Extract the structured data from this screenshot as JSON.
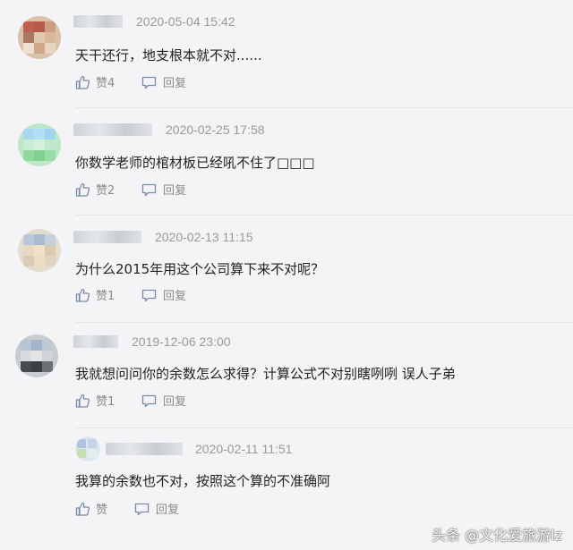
{
  "comments": [
    {
      "time": "2020-05-04 15:42",
      "text": "天干还行，地支根本就不对......",
      "like_label": "赞4",
      "reply_label": "回复"
    },
    {
      "time": "2020-02-25 17:58",
      "text": "你数学老师的棺材板已经吼不住了□□□",
      "like_label": "赞2",
      "reply_label": "回复"
    },
    {
      "time": "2020-02-13 11:15",
      "text": "为什么2015年用这个公司算下来不对呢？",
      "like_label": "赞1",
      "reply_label": "回复"
    },
    {
      "time": "2019-12-06 23:00",
      "text": "我就想问问你的余数怎么求得？计算公式不对别瞎咧咧 误人子弟",
      "like_label": "赞1",
      "reply_label": "回复"
    }
  ],
  "reply": {
    "time": "2020-02-11 11:51",
    "text": "我算的余数也不对，按照这个算的不准确阿",
    "like_label": "赞",
    "reply_label": "回复"
  },
  "watermark": "头条 @文化爱旅游lz",
  "icons": {
    "like": "thumbs-up-icon",
    "reply": "comment-bubble-icon"
  },
  "colors": {
    "background": "#f4f4f6",
    "text": "#222222",
    "meta": "#999999"
  }
}
